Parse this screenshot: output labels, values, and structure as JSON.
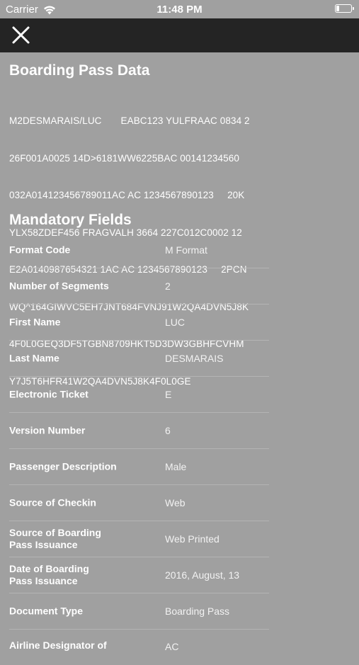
{
  "status_bar": {
    "carrier": "Carrier",
    "time": "11:48 PM",
    "wifi_icon": "wifi-icon",
    "battery_icon": "battery-icon"
  },
  "nav": {
    "close_icon": "close-icon"
  },
  "boarding_pass": {
    "title": "Boarding Pass Data",
    "lines": [
      "M2DESMARAIS/LUC       EABC123 YULFRAAC 0834 2",
      "26F001A0025 14D>6181WW6225BAC 00141234560",
      "032A014123456789011AC AC 1234567890123     20K",
      "YLX58ZDEF456 FRAGVALH 3664 227C012C0002 12",
      "E2A0140987654321 1AC AC 1234567890123     2PCN",
      "WQ^164GIWVC5EH7JNT684FVNJ91W2QA4DVN5J8K",
      "4F0L0GEQ3DF5TGBN8709HKT5D3DW3GBHFCVHM",
      "Y7J5T6HFR41W2QA4DVN5J8K4F0L0GE"
    ]
  },
  "mandatory": {
    "title": "Mandatory Fields",
    "fields": [
      {
        "label": "Format Code",
        "value": "M Format"
      },
      {
        "label": "Number of Segments",
        "value": "2"
      },
      {
        "label": "First Name",
        "value": "LUC"
      },
      {
        "label": "Last Name",
        "value": "DESMARAIS"
      },
      {
        "label": "Electronic Ticket",
        "value": "E"
      },
      {
        "label": "Version Number",
        "value": "6"
      },
      {
        "label": "Passenger Description",
        "value": "Male"
      },
      {
        "label": "Source of Checkin",
        "value": "Web"
      },
      {
        "label": "Source of Boarding\nPass Issuance",
        "value": "Web Printed"
      },
      {
        "label": "Date of Boarding\nPass Issuance",
        "value": "2016, August, 13"
      },
      {
        "label": "Document Type",
        "value": "Boarding Pass"
      },
      {
        "label": "Airline Designator of",
        "value": "AC"
      }
    ]
  }
}
